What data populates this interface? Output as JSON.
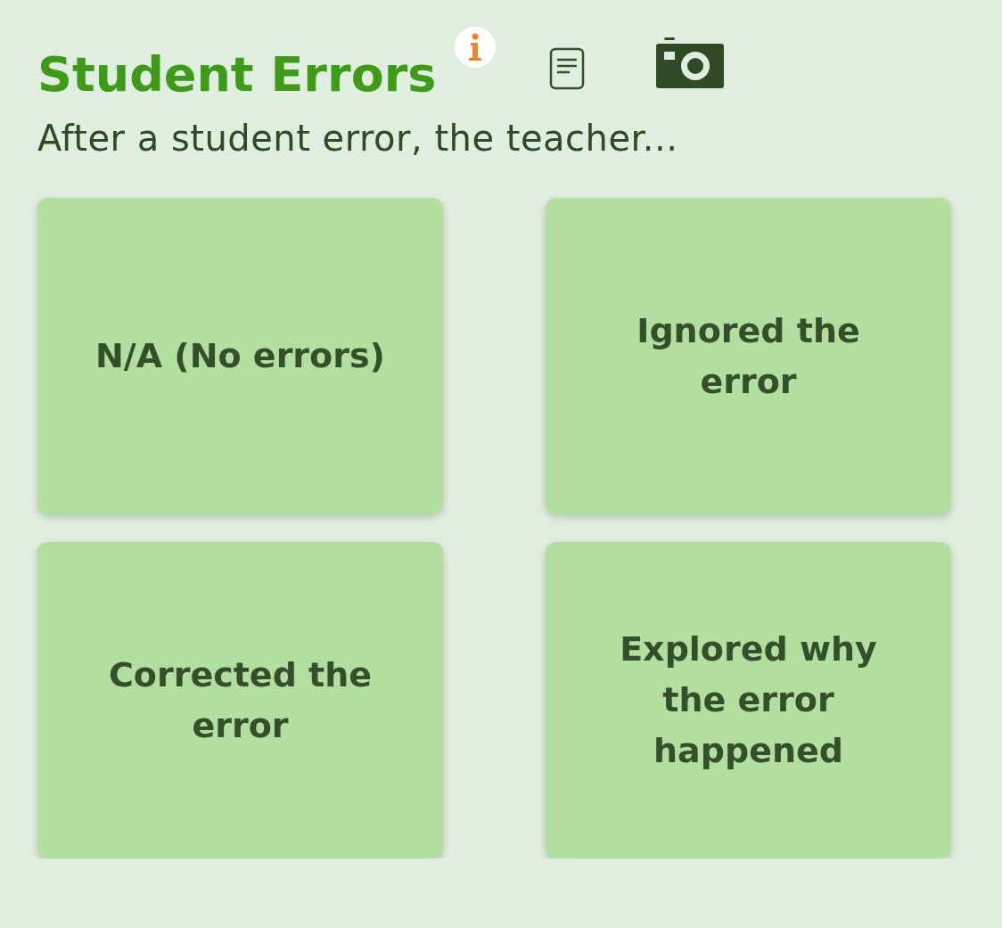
{
  "title": "Student Errors",
  "prompt": "After a student error, the teacher...",
  "options": [
    {
      "label": "N/A (No errors)"
    },
    {
      "label": "Ignored the error"
    },
    {
      "label": "Corrected the error"
    },
    {
      "label": "Explored why the error happened"
    }
  ]
}
